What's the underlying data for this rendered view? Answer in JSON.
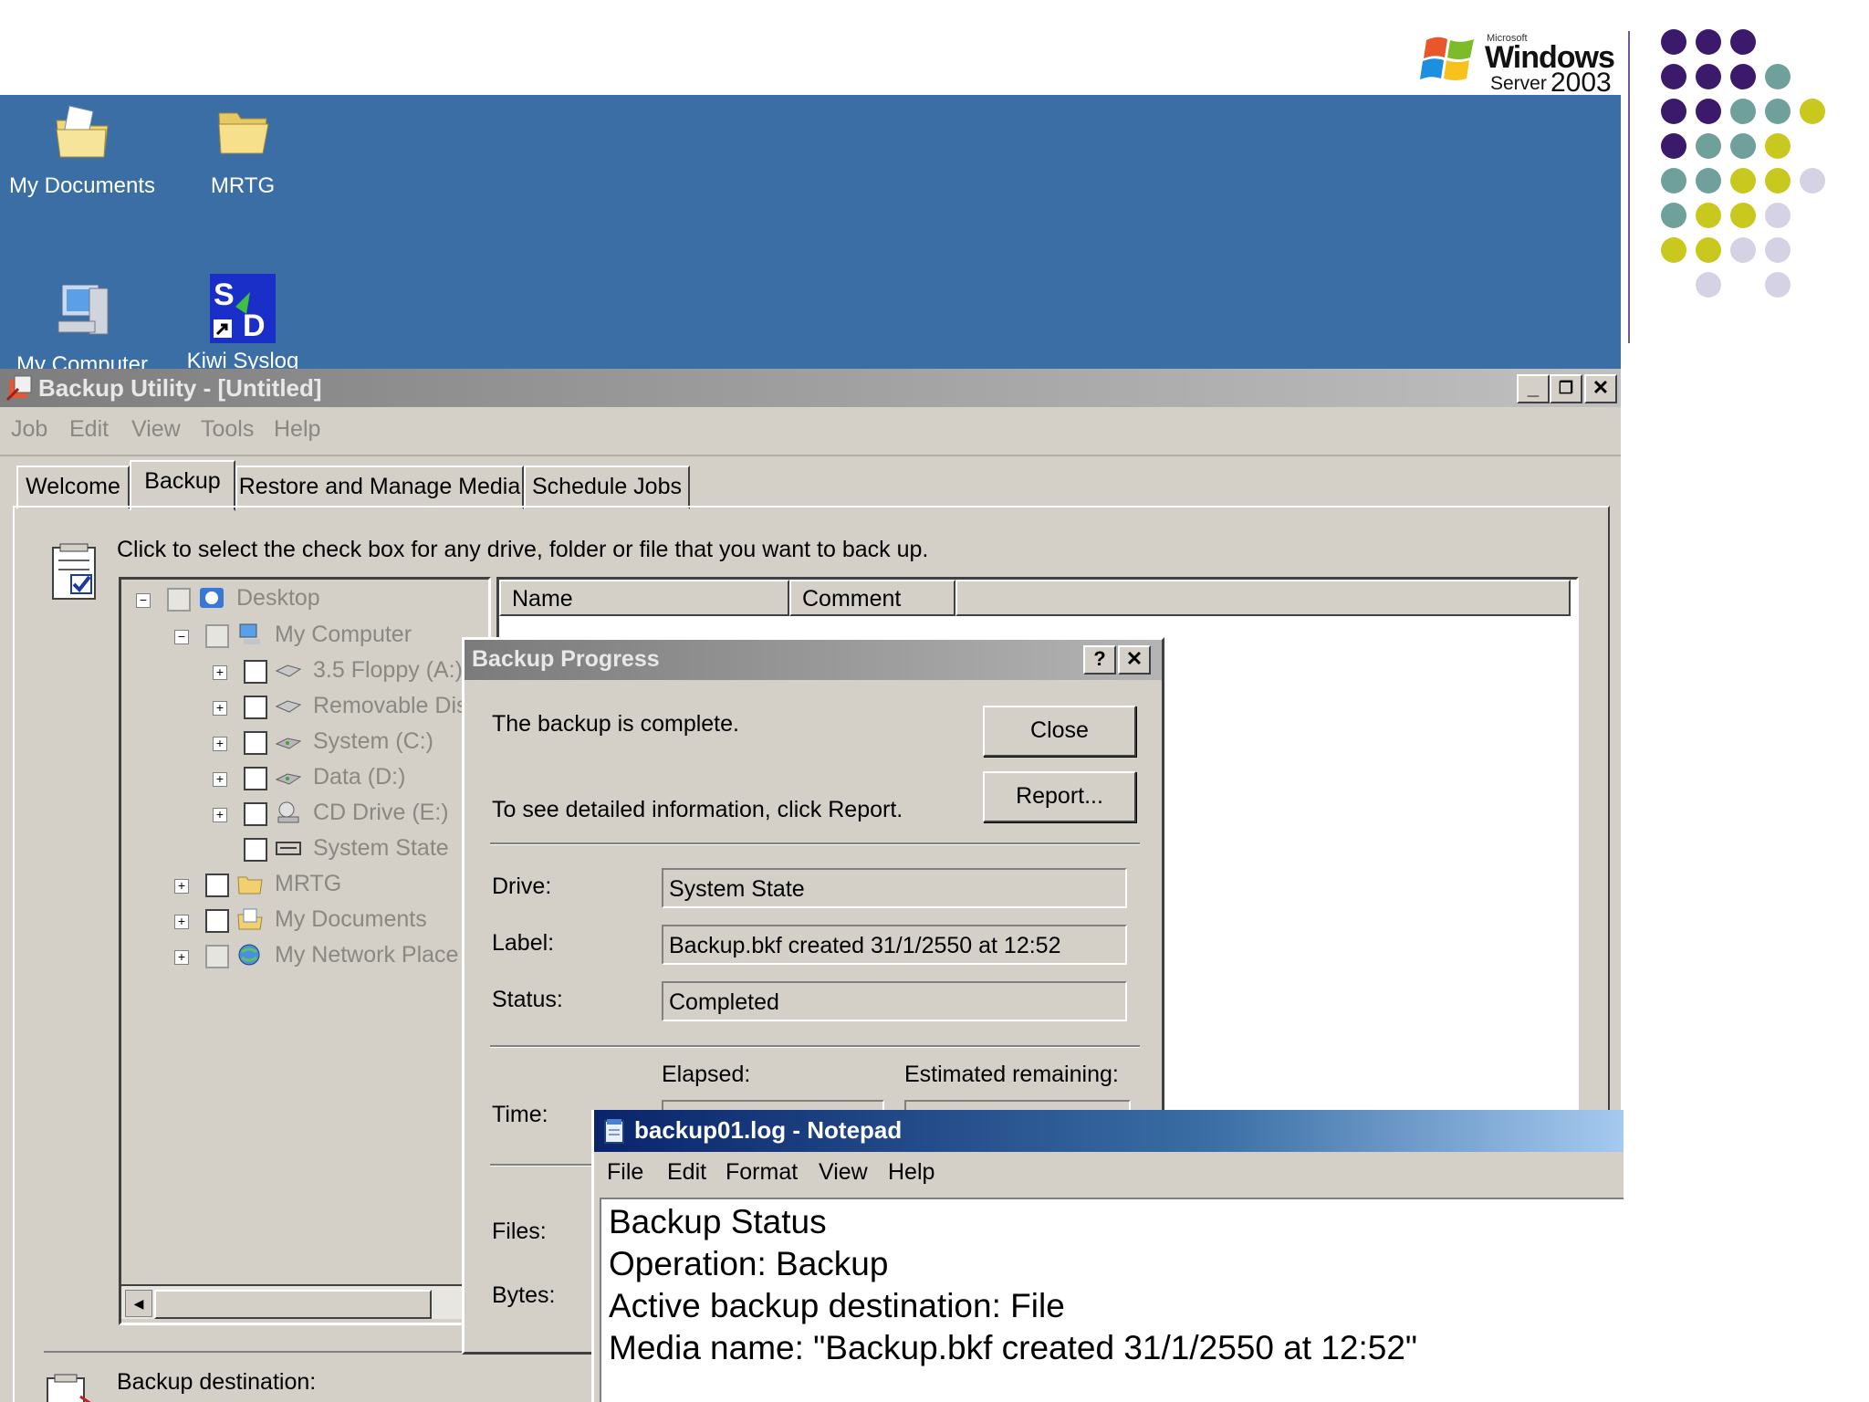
{
  "logo": {
    "microsoft": "Microsoft",
    "windows": "Windows",
    "server": "Server",
    "year": "2003"
  },
  "colors": {
    "desktop": "#3b6ea5",
    "dot_purple": "#3b1a6b",
    "dot_teal": "#6fa09c",
    "dot_yellow": "#c8c81e",
    "dot_lavender": "#d6d2e6",
    "notepad_title": "#0a246a"
  },
  "desktop": {
    "icons": [
      {
        "label": "My Documents",
        "icon": "my-documents-icon"
      },
      {
        "label": "MRTG",
        "icon": "folder-icon"
      },
      {
        "label": "My Computer",
        "icon": "my-computer-icon"
      },
      {
        "label": "Kiwi Syslog",
        "icon": "kiwi-syslog-icon"
      }
    ]
  },
  "backup_window": {
    "title": "Backup Utility - [Untitled]",
    "menu": [
      "Job",
      "Edit",
      "View",
      "Tools",
      "Help"
    ],
    "tabs": [
      "Welcome",
      "Backup",
      "Restore and Manage Media",
      "Schedule Jobs"
    ],
    "active_tab": "Backup",
    "instruction": "Click to select the check box for any drive, folder or file that you want to back up.",
    "tree": [
      {
        "label": "Desktop",
        "icon": "desktop-icon"
      },
      {
        "label": "My Computer",
        "icon": "computer-icon"
      },
      {
        "label": "3.5 Floppy (A:)",
        "icon": "floppy-icon"
      },
      {
        "label": "Removable Dis",
        "icon": "removable-disk-icon"
      },
      {
        "label": "System (C:)",
        "icon": "hard-drive-icon"
      },
      {
        "label": "Data (D:)",
        "icon": "hard-drive-icon"
      },
      {
        "label": "CD Drive (E:)",
        "icon": "cd-drive-icon"
      },
      {
        "label": "System State",
        "icon": "system-state-icon"
      },
      {
        "label": "MRTG",
        "icon": "folder-icon"
      },
      {
        "label": "My Documents",
        "icon": "documents-icon"
      },
      {
        "label": "My Network Place",
        "icon": "network-icon"
      }
    ],
    "list_columns": [
      "Name",
      "Comment"
    ],
    "destination_label": "Backup destination:"
  },
  "progress_dialog": {
    "title": "Backup Progress",
    "help": "?",
    "close_x": "✕",
    "message": "The backup is complete.",
    "report_hint": "To see detailed information, click Report.",
    "close_button": "Close",
    "report_button": "Report...",
    "drive_label": "Drive:",
    "drive_value": "System State",
    "label_label": "Label:",
    "label_value": "Backup.bkf created 31/1/2550 at 12:52",
    "status_label": "Status:",
    "status_value": "Completed",
    "time_label": "Time:",
    "elapsed_label": "Elapsed:",
    "remaining_label": "Estimated remaining:",
    "files_label": "Files:",
    "bytes_label": "Bytes:"
  },
  "notepad": {
    "title": "backup01.log - Notepad",
    "menu": [
      "File",
      "Edit",
      "Format",
      "View",
      "Help"
    ],
    "lines": [
      "Backup Status",
      "Operation: Backup",
      "Active backup destination: File",
      "Media name: \"Backup.bkf created 31/1/2550 at 12:52\""
    ]
  }
}
